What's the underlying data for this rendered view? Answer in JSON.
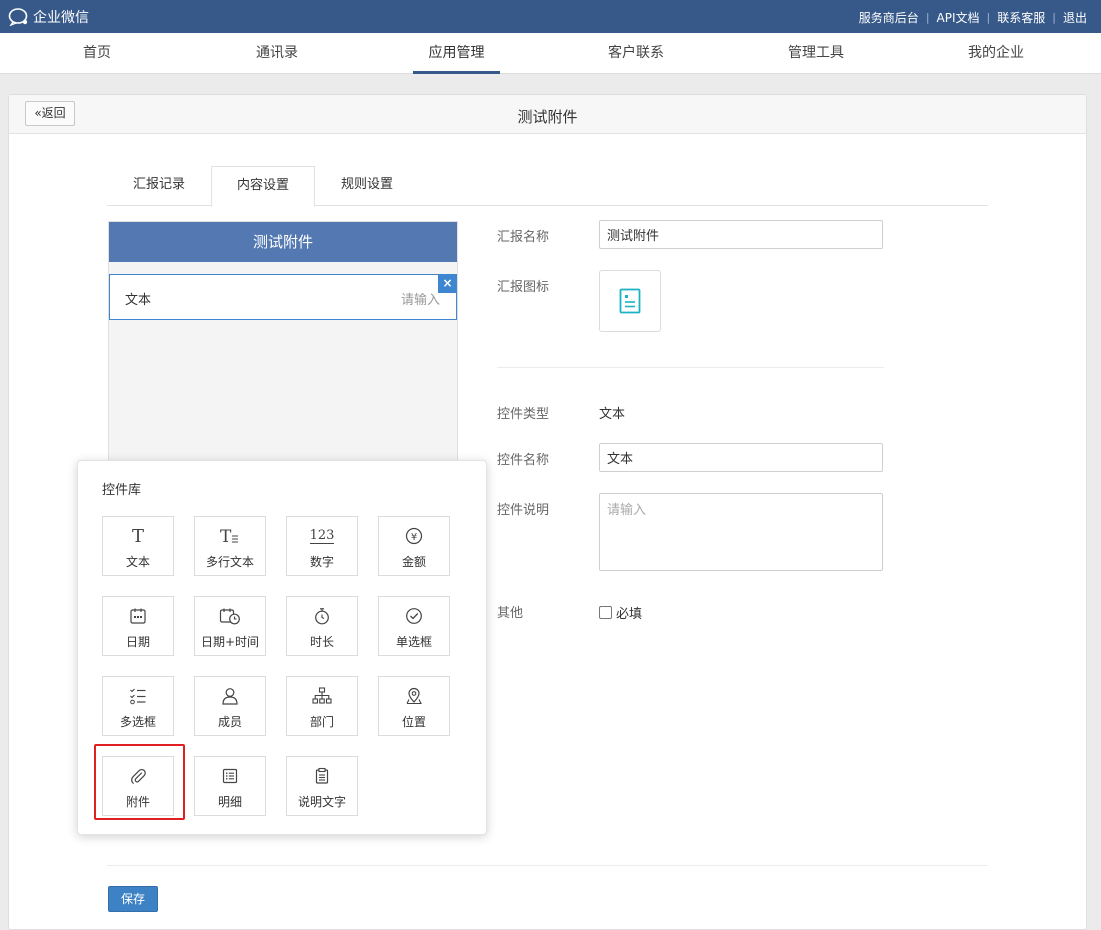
{
  "header": {
    "logo_text": "企业微信",
    "links": [
      "服务商后台",
      "API文档",
      "联系客服",
      "退出"
    ]
  },
  "nav": {
    "items": [
      "首页",
      "通讯录",
      "应用管理",
      "客户联系",
      "管理工具",
      "我的企业"
    ],
    "active": "应用管理"
  },
  "panel": {
    "back_label": "返回",
    "title": "测试附件"
  },
  "tabs": {
    "items": [
      "汇报记录",
      "内容设置",
      "规则设置"
    ],
    "active": "内容设置"
  },
  "preview": {
    "title": "测试附件",
    "field_label": "文本",
    "field_placeholder": "请输入",
    "delete_symbol": "×"
  },
  "form": {
    "report_name_label": "汇报名称",
    "report_name_value": "测试附件",
    "report_icon_label": "汇报图标",
    "control_type_label": "控件类型",
    "control_type_value": "文本",
    "control_name_label": "控件名称",
    "control_name_value": "文本",
    "control_desc_label": "控件说明",
    "control_desc_placeholder": "请输入",
    "other_label": "其他",
    "required_label": "必填"
  },
  "library": {
    "title": "控件库",
    "items": [
      {
        "label": "文本",
        "icon": "text-icon"
      },
      {
        "label": "多行文本",
        "icon": "multiline-text-icon"
      },
      {
        "label": "数字",
        "icon": "number-icon"
      },
      {
        "label": "金额",
        "icon": "yen-icon"
      },
      {
        "label": "日期",
        "icon": "calendar-icon"
      },
      {
        "label": "日期+时间",
        "icon": "calendar-clock-icon"
      },
      {
        "label": "时长",
        "icon": "stopwatch-icon"
      },
      {
        "label": "单选框",
        "icon": "check-circle-icon"
      },
      {
        "label": "多选框",
        "icon": "checklist-icon"
      },
      {
        "label": "成员",
        "icon": "person-icon"
      },
      {
        "label": "部门",
        "icon": "org-chart-icon"
      },
      {
        "label": "位置",
        "icon": "location-icon"
      },
      {
        "label": "附件",
        "icon": "paperclip-icon"
      },
      {
        "label": "明细",
        "icon": "detail-list-icon"
      },
      {
        "label": "说明文字",
        "icon": "description-icon"
      }
    ],
    "icon_glyphs": {
      "text": "T",
      "number": "123",
      "yen": "¥"
    }
  },
  "footer": {
    "save_label": "保存"
  },
  "colors": {
    "topbar": "#37598a",
    "preview_header": "#5479b2",
    "accent_blue": "#3f86d0",
    "save_button": "#3e82c6",
    "icon_teal": "#19b3c3",
    "highlight_red": "#e02020"
  }
}
